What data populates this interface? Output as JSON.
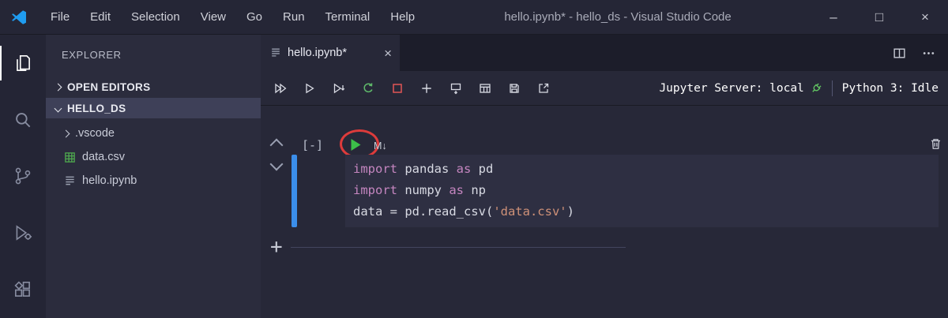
{
  "colors": {
    "accent_blue": "#3b8eea",
    "run_green": "#3cbf49",
    "restart_green": "#5fb96a",
    "stop_red": "#e25555",
    "annotation_red": "#dd3b3b",
    "csv_green": "#4fa94f",
    "plug_green": "#62c462"
  },
  "titlebar": {
    "menus": [
      "File",
      "Edit",
      "Selection",
      "View",
      "Go",
      "Run",
      "Terminal",
      "Help"
    ],
    "title": "hello.ipynb* - hello_ds - Visual Studio Code",
    "window_controls": {
      "minimize": "–",
      "maximize": "□",
      "close": "×"
    }
  },
  "activity_bar": {
    "items": [
      "explorer-icon",
      "search-icon",
      "source-control-icon",
      "run-debug-icon",
      "extensions-icon"
    ],
    "active_item": "explorer-icon"
  },
  "sidebar": {
    "header": "EXPLORER",
    "sections": {
      "open_editors": "OPEN EDITORS",
      "workspace": "HELLO_DS"
    },
    "files": [
      {
        "label": ".vscode",
        "type": "folder",
        "icon": "chevron-right-icon"
      },
      {
        "label": "data.csv",
        "type": "csv",
        "icon": "csv-table-icon"
      },
      {
        "label": "hello.ipynb",
        "type": "notebook",
        "icon": "notebook-icon"
      }
    ]
  },
  "editor": {
    "tab": {
      "label": "hello.ipynb*",
      "close": "×",
      "icon": "notebook-icon"
    },
    "tab_actions": [
      "split-editor-icon",
      "more-actions-icon"
    ],
    "toolbar": {
      "icons": [
        "run-all-icon",
        "run-above-icon",
        "run-below-icon",
        "restart-kernel-icon",
        "interrupt-kernel-icon",
        "add-cell-icon",
        "insert-cell-below-icon",
        "variable-explorer-icon",
        "save-icon",
        "export-icon"
      ],
      "jupyter_server": "Jupyter Server: local",
      "jupyter_server_icon": "plug-connected-icon",
      "kernel_status": "Python 3: Idle"
    },
    "cell": {
      "execution_label": "[-]",
      "run_icon": "run-cell-icon",
      "markdown_toggle": "M↓",
      "delete_icon": "trash-icon",
      "annotation": "red-circle-highlight-on-run-button",
      "token_colors": {
        "keyword": "#c586c0",
        "plain": "#d8dae3",
        "string": "#ce9178"
      },
      "code_lines": [
        [
          {
            "t": "import",
            "c": "keyword"
          },
          {
            "t": " pandas ",
            "c": "plain"
          },
          {
            "t": "as",
            "c": "keyword"
          },
          {
            "t": " pd",
            "c": "plain"
          }
        ],
        [
          {
            "t": "import",
            "c": "keyword"
          },
          {
            "t": " numpy ",
            "c": "plain"
          },
          {
            "t": "as",
            "c": "keyword"
          },
          {
            "t": " np",
            "c": "plain"
          }
        ],
        [
          {
            "t": "data = pd.read_csv(",
            "c": "plain"
          },
          {
            "t": "'data.csv'",
            "c": "string"
          },
          {
            "t": ")",
            "c": "plain"
          }
        ]
      ]
    },
    "add_cell": {
      "plus": "+"
    }
  }
}
